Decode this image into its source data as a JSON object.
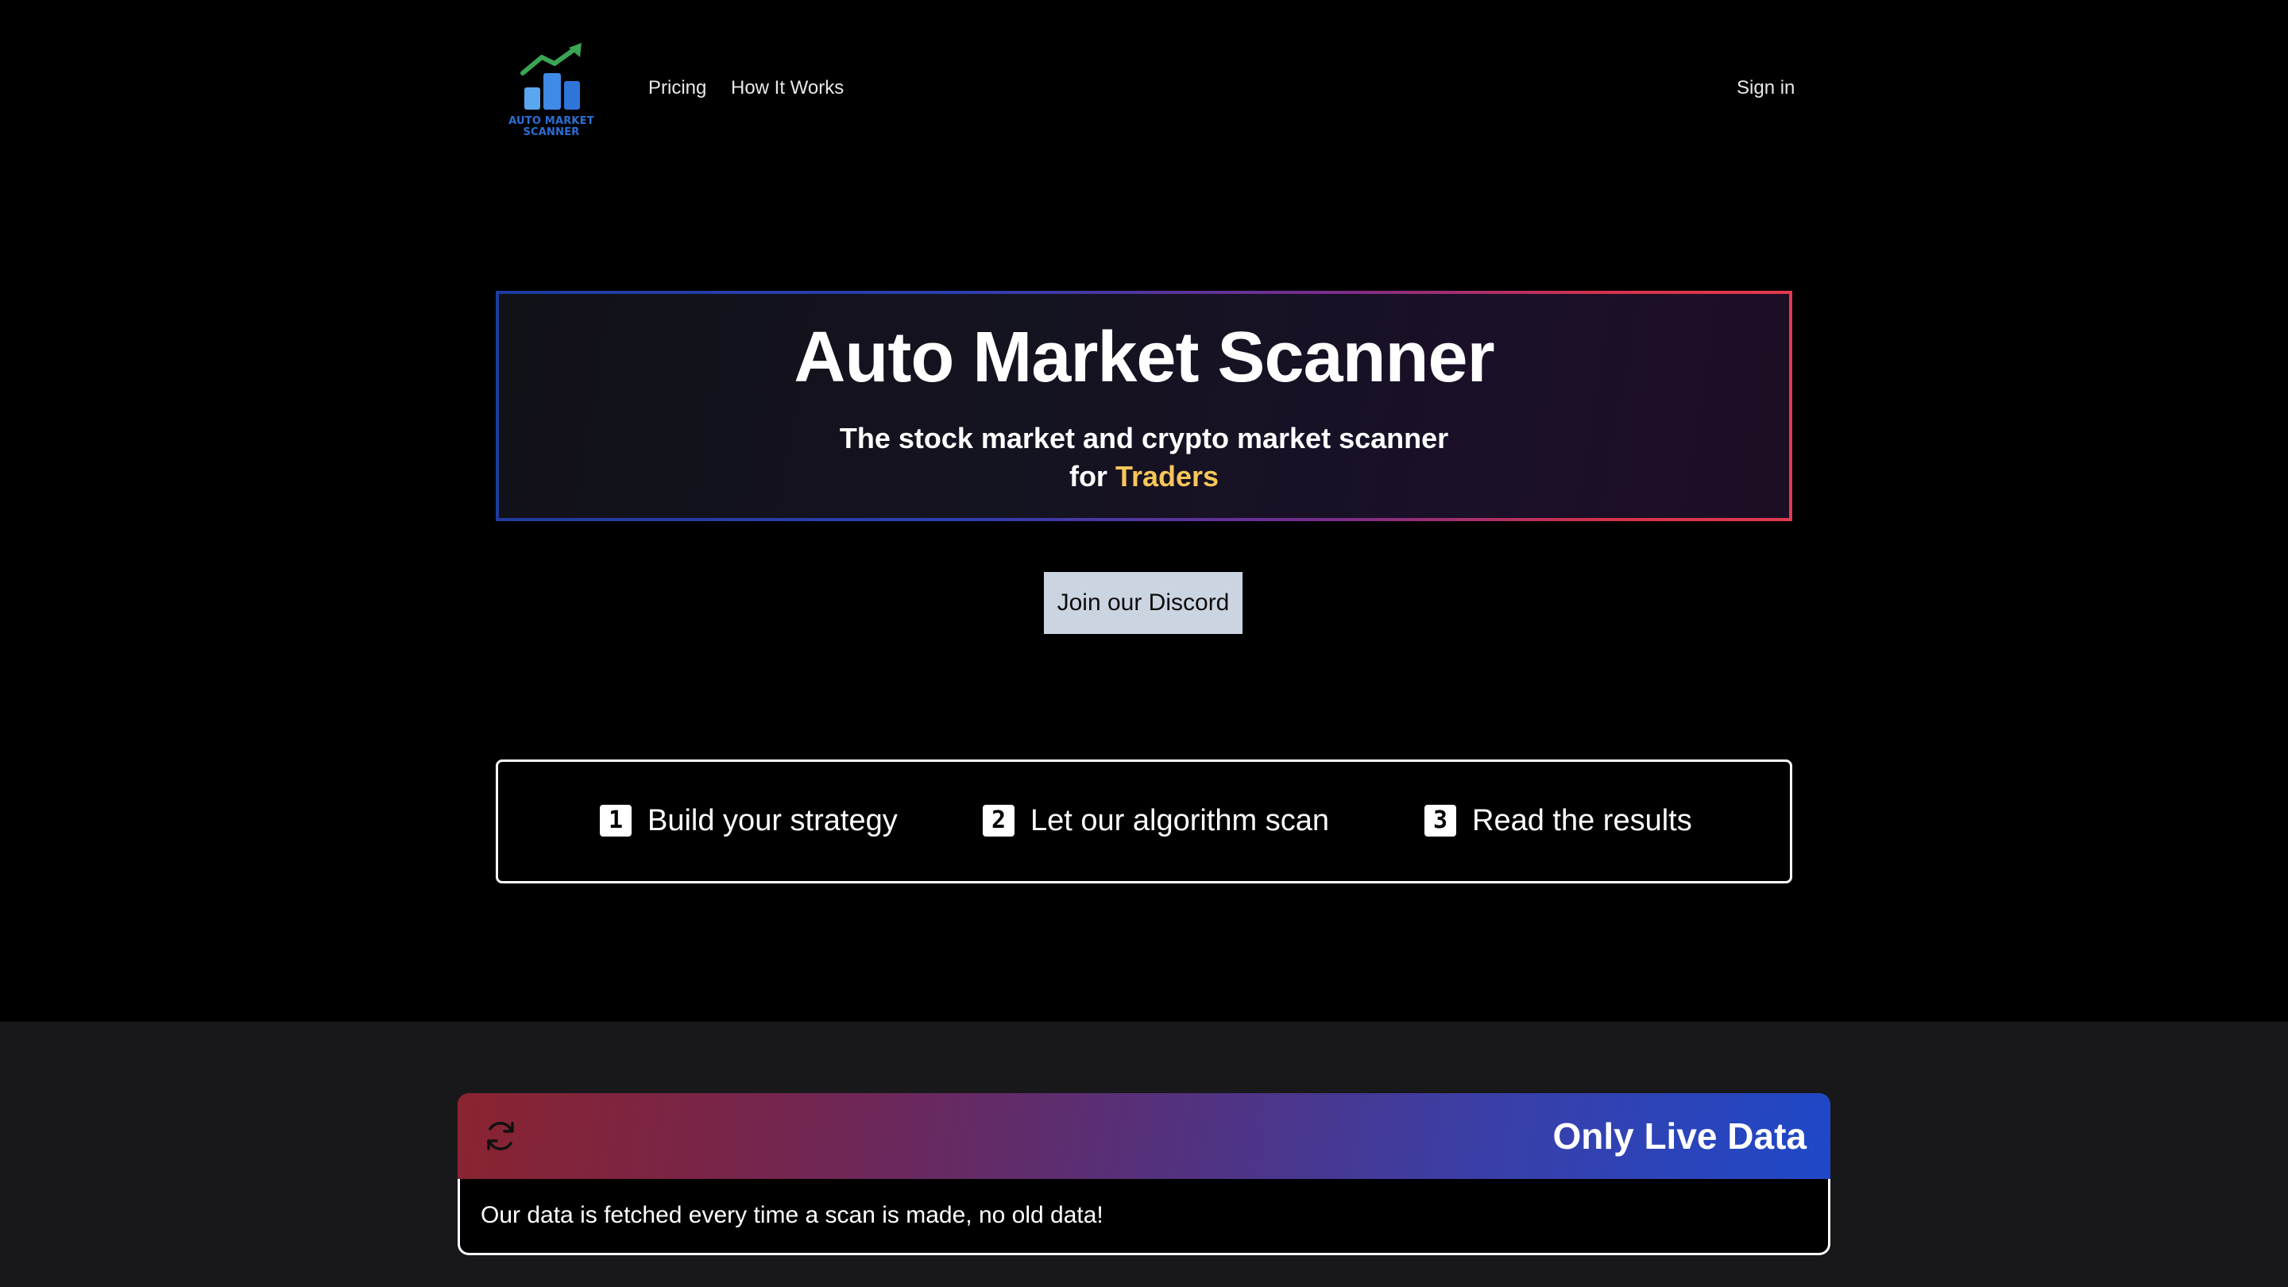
{
  "header": {
    "logo_text": "AUTO MARKET SCANNER",
    "nav": {
      "pricing": "Pricing",
      "how_it_works": "How It Works"
    },
    "sign_in": "Sign in"
  },
  "hero": {
    "title": "Auto Market Scanner",
    "subtitle_line1": "The stock market and crypto market scanner",
    "subtitle_prefix": "for",
    "subtitle_highlight": "Traders"
  },
  "discord_button": {
    "label": "Join our Discord"
  },
  "steps": [
    {
      "number": "1",
      "label": "Build your strategy"
    },
    {
      "number": "2",
      "label": "Let our algorithm scan"
    },
    {
      "number": "3",
      "label": "Read the results"
    }
  ],
  "feature": {
    "title": "Only Live Data",
    "description": "Our data is fetched every time a scan is made, no old data!",
    "icon": "refresh-icon"
  },
  "colors": {
    "background": "#000000",
    "lower_section": "#18181b",
    "highlight": "#f7c65a",
    "button": "#cbd5e1",
    "logo_blue": "#2b6fd6",
    "logo_green": "#3aa655"
  }
}
